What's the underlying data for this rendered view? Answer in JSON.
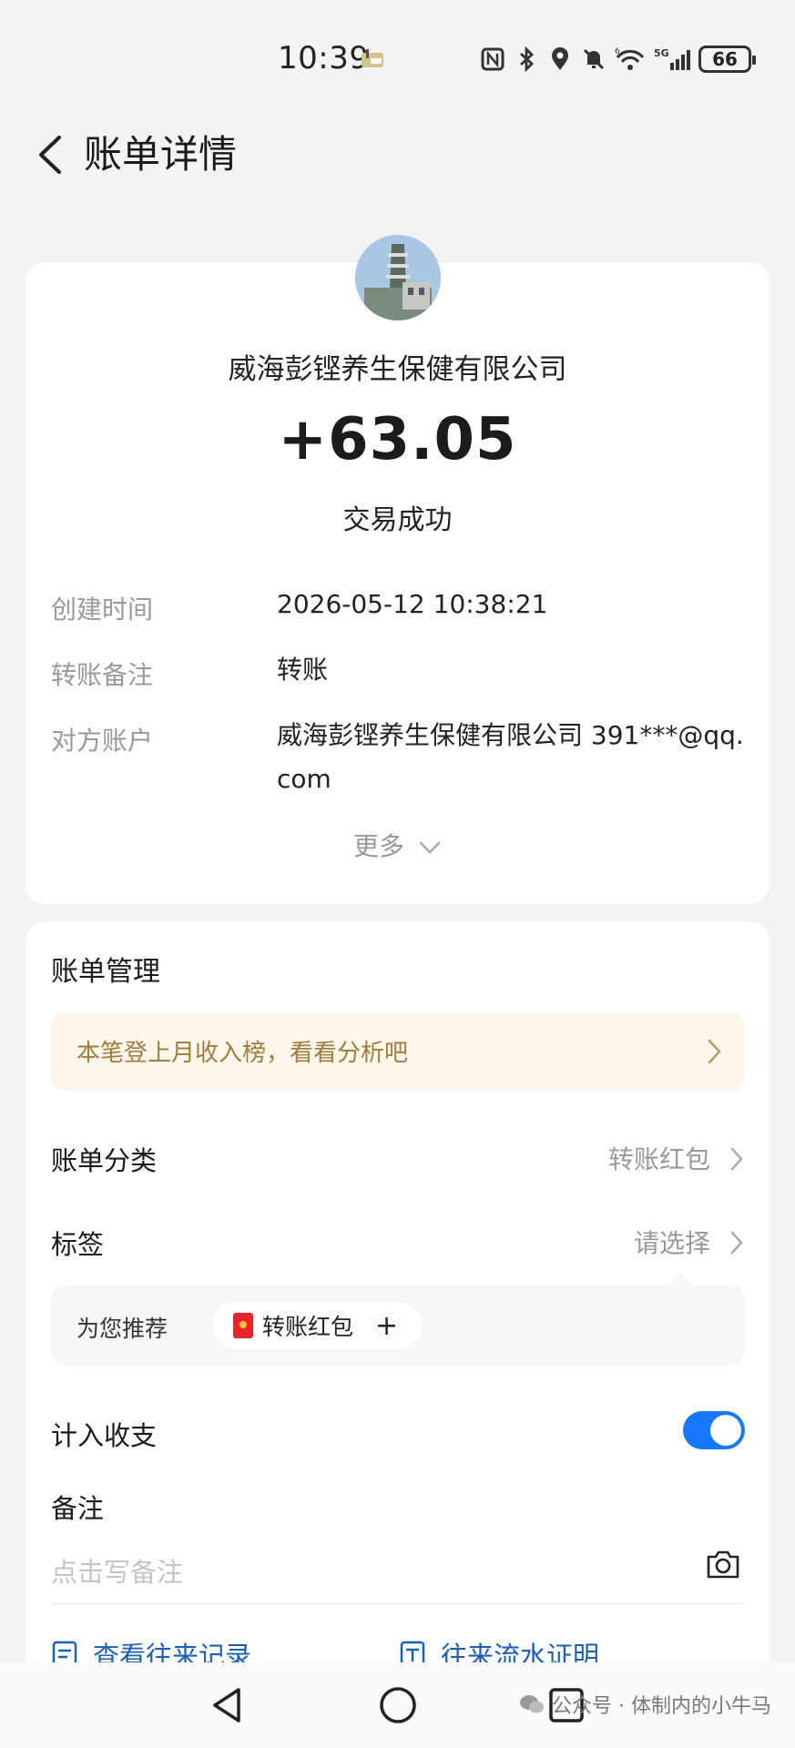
{
  "status_bar": {
    "time": "10:39",
    "battery": "66"
  },
  "header": {
    "title": "账单详情"
  },
  "transaction": {
    "merchant": "威海彭铿养生保健有限公司",
    "amount": "+63.05",
    "status": "交易成功",
    "details": [
      {
        "label": "创建时间",
        "value": "2026-05-12 10:38:21"
      },
      {
        "label": "转账备注",
        "value": "转账"
      },
      {
        "label": "对方账户",
        "value": "威海彭铿养生保健有限公司 391***@qq.com"
      }
    ],
    "more_label": "更多"
  },
  "management": {
    "title": "账单管理",
    "promo_text": "本笔登上月收入榜，看看分析吧",
    "category_label": "账单分类",
    "category_value": "转账红包",
    "tag_label": "标签",
    "tag_value": "请选择",
    "recommend_label": "为您推荐",
    "recommend_chip": "转账红包",
    "include_label": "计入收支",
    "include_enabled": true,
    "note_label": "备注",
    "note_placeholder": "点击写备注",
    "link_records": "查看往来记录",
    "link_statement": "往来流水证明"
  },
  "watermark": "公众号 · 体制内的小牛马",
  "colors": {
    "accent": "#1677ff",
    "promo_bg": "#fdf6ea",
    "promo_text": "#a07c3f",
    "link": "#1a5fb4"
  },
  "icons": {
    "back": "chevron-left-icon",
    "camera": "camera-icon",
    "nav_back": "triangle-back-icon",
    "nav_home": "circle-home-icon",
    "nav_recent": "square-recent-icon"
  }
}
